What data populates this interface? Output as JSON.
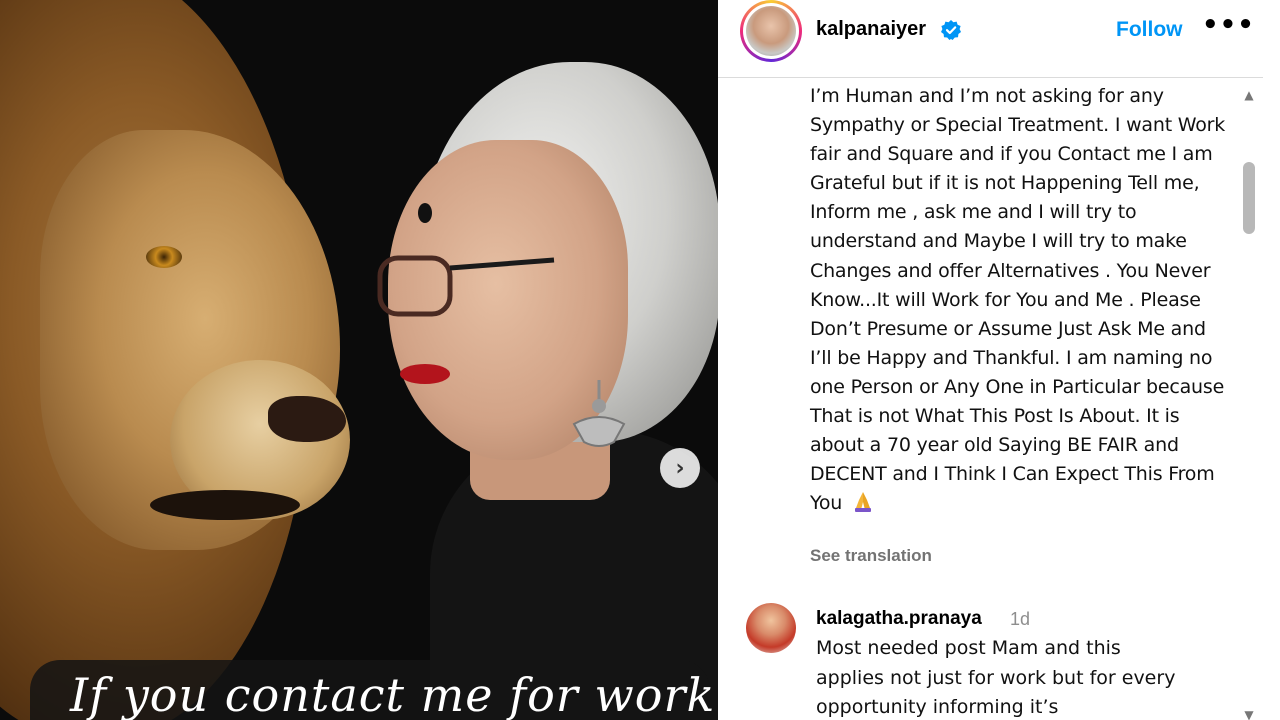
{
  "post": {
    "image_overlay_text": "If you contact me for work",
    "next_icon": "chevron-right-icon"
  },
  "header": {
    "username": "kalpanaiyer",
    "verified_icon": "verified-badge-icon",
    "follow_label": "Follow",
    "more_label": "•••"
  },
  "caption": {
    "text": "I’m Human and I’m not asking for any Sympathy or Special Treatment. I want Work fair and Square and if you Contact me I am Grateful but if it is not Happening Tell me, Inform me , ask me and I will try to understand and Maybe I will try to make Changes and offer Alternatives . You Never Know...It will Work for You and Me . Please Don’t Presume or Assume Just Ask Me and I’ll be Happy and Thankful. I am naming no one Person or Any One in Particular because That is not What This Post Is About. It is about a 70 year old Saying BE FAIR and DECENT and I Think I Can Expect This From You",
    "emoji": "folded-hands-emoji",
    "see_translation": "See translation"
  },
  "comment": {
    "username": "kalagatha.pranaya",
    "time": "1d",
    "text": "Most needed post Mam and this applies not just for work but for every opportunity informing it’s"
  },
  "scrollbar": {
    "up": "▲",
    "down": "▼"
  },
  "colors": {
    "follow": "#0095f6",
    "secondary_text": "#737373",
    "media_background": "#0b0b0b"
  }
}
